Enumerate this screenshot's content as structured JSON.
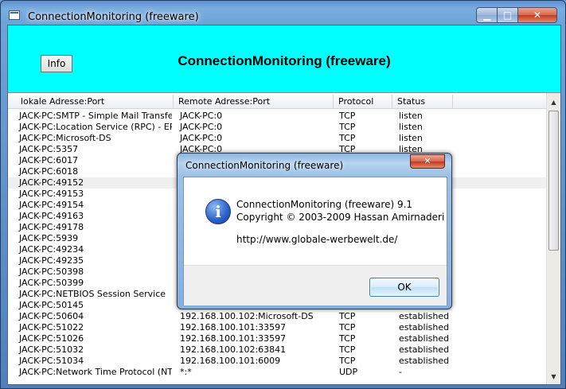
{
  "window": {
    "title": "ConnectionMonitoring (freeware)",
    "min_glyph": "▁",
    "max_glyph": "□",
    "close_glyph": "✕"
  },
  "banner": {
    "info_label": "Info",
    "title": "ConnectionMonitoring (freeware)",
    "color": "#00ffff"
  },
  "table": {
    "columns": [
      "lokale Adresse:Port",
      "Remote Adresse:Port",
      "Protocol",
      "Status"
    ],
    "rows": [
      [
        "JACK-PC:SMTP - Simple Mail Transfer ...",
        "JACK-PC:0",
        "TCP",
        "listen"
      ],
      [
        "JACK-PC:Location Service (RPC) - EP...",
        "JACK-PC:0",
        "TCP",
        "listen"
      ],
      [
        "JACK-PC:Microsoft-DS",
        "JACK-PC:0",
        "TCP",
        "listen"
      ],
      [
        "JACK-PC:5357",
        "JACK-PC:0",
        "TCP",
        "listen"
      ],
      [
        "JACK-PC:6017",
        "",
        "",
        ""
      ],
      [
        "JACK-PC:6018",
        "",
        "",
        ""
      ],
      [
        "JACK-PC:49152",
        "",
        "",
        ""
      ],
      [
        "JACK-PC:49153",
        "",
        "",
        ""
      ],
      [
        "JACK-PC:49154",
        "",
        "",
        ""
      ],
      [
        "JACK-PC:49163",
        "",
        "",
        ""
      ],
      [
        "JACK-PC:49178",
        "",
        "",
        ""
      ],
      [
        "JACK-PC:5939",
        "",
        "",
        ""
      ],
      [
        "JACK-PC:49234",
        "",
        "",
        ""
      ],
      [
        "JACK-PC:49235",
        "",
        "",
        ""
      ],
      [
        "JACK-PC:50398",
        "",
        "",
        ""
      ],
      [
        "JACK-PC:50399",
        "",
        "",
        ""
      ],
      [
        "JACK-PC:NETBIOS Session Service",
        "",
        "",
        ""
      ],
      [
        "JACK-PC:50145",
        "",
        "",
        ""
      ],
      [
        "JACK-PC:50604",
        "192.168.100.102:Microsoft-DS",
        "TCP",
        "established"
      ],
      [
        "JACK-PC:51022",
        "192.168.100.101:33597",
        "TCP",
        "established"
      ],
      [
        "JACK-PC:51026",
        "192.168.100.101:33597",
        "TCP",
        "established"
      ],
      [
        "JACK-PC:51032",
        "192.168.100.102:63841",
        "TCP",
        "established"
      ],
      [
        "JACK-PC:51034",
        "192.168.100.101:6009",
        "TCP",
        "established"
      ],
      [
        "JACK-PC:Network Time Protocol (NTP)",
        "*:*",
        "UDP",
        "-"
      ]
    ],
    "selected_row": 6
  },
  "dialog": {
    "title": "ConnectionMonitoring (freeware)",
    "close_glyph": "✕",
    "icon_glyph": "i",
    "line1": "ConnectionMonitoring (freeware) 9.1",
    "line2": "Copyright © 2003-2009 Hassan Amirnaderi",
    "url": "http://www.globale-werbewelt.de/",
    "ok_label": "OK"
  }
}
